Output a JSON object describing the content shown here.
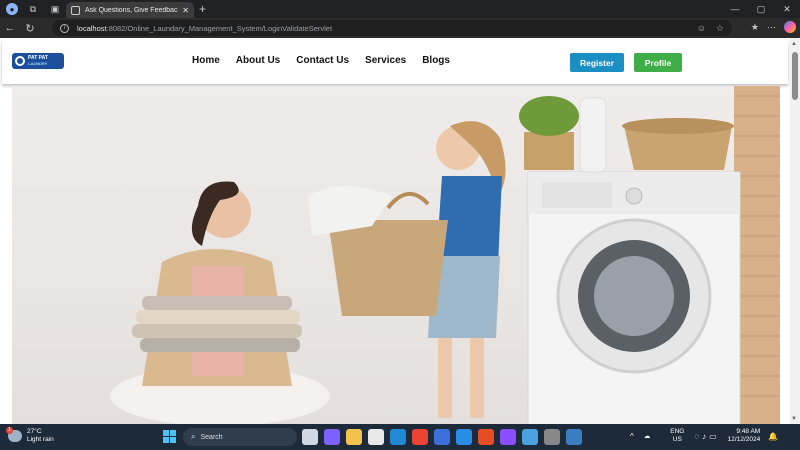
{
  "browser": {
    "tab_title": "Ask Questions, Give Feedback, and...",
    "url_host": "localhost",
    "url_path": ":8082/Online_Laundary_Management_System/LoginValidateServlet"
  },
  "site": {
    "logo_text": "PAT PAT",
    "logo_sub": "LAUNDRY",
    "nav": [
      "Home",
      "About Us",
      "Contact Us",
      "Services",
      "Blogs"
    ],
    "register_label": "Register",
    "profile_label": "Profile",
    "colors": {
      "register": "#1a8fc4",
      "profile": "#3fae49"
    }
  },
  "hero": {
    "description_icon": "laundry-hero-image"
  },
  "taskbar": {
    "temperature": "27°C",
    "weather": "Light rain",
    "weather_badge": "1",
    "search_label": "Search",
    "lang_top": "ENG",
    "lang_bottom": "US",
    "time": "9:48 AM",
    "date": "12/12/2024"
  }
}
